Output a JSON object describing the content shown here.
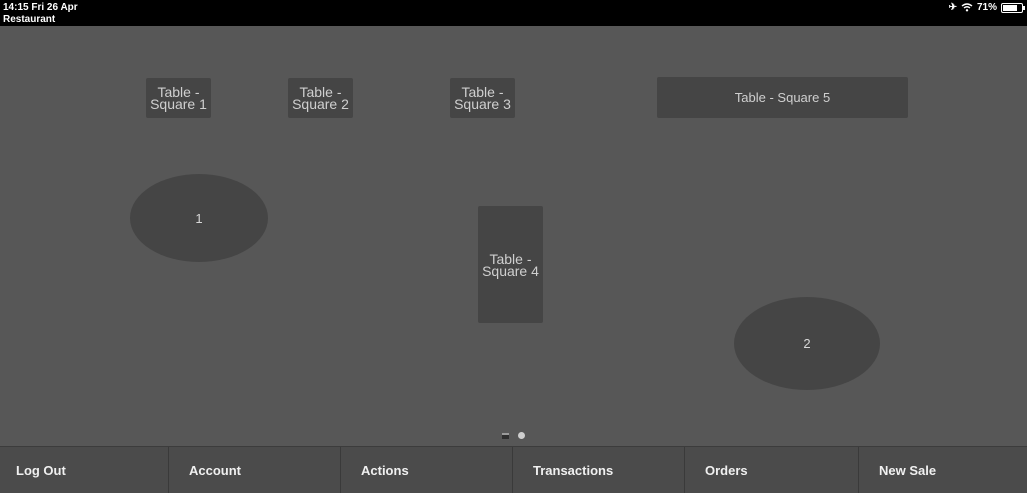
{
  "status_bar": {
    "time_date": "14:15   Fri 26 Apr",
    "app_title": "Restaurant",
    "battery": "71%",
    "battery_level": 0.71
  },
  "tables": [
    {
      "id": "square-1",
      "label": "Table - Square 1"
    },
    {
      "id": "square-2",
      "label": "Table - Square 2"
    },
    {
      "id": "square-3",
      "label": "Table - Square 3"
    },
    {
      "id": "square-5",
      "label": "Table - Square 5"
    },
    {
      "id": "square-4",
      "label": "Table - Square 4"
    }
  ],
  "round_tables": [
    {
      "id": "round-1",
      "label": "1"
    },
    {
      "id": "round-2",
      "label": "2"
    }
  ],
  "pager": {
    "pages": 2,
    "current": 2
  },
  "bottom_bar": {
    "log_out": "Log Out",
    "account": "Account",
    "actions": "Actions",
    "transactions": "Transactions",
    "orders": "Orders",
    "new_sale": "New Sale"
  },
  "colors": {
    "background": "#575757",
    "table_fill": "#454545",
    "bar": "#4a4a4a"
  }
}
